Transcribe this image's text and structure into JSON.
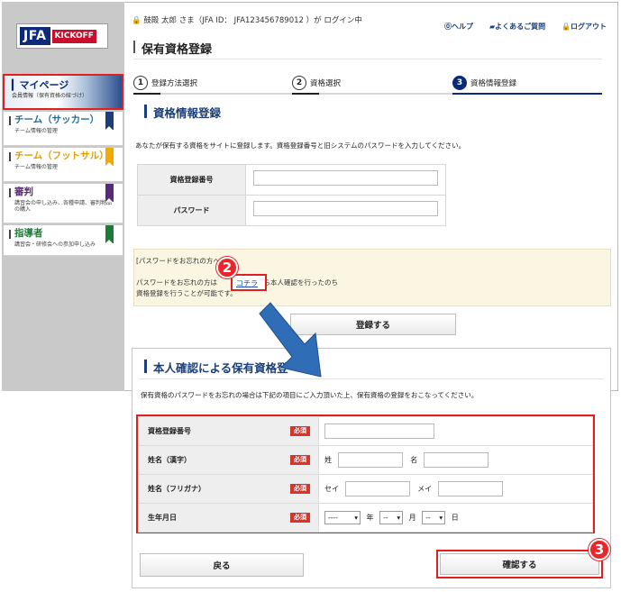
{
  "logo": {
    "jfa": "JFA",
    "kickoff": "KICKOFF"
  },
  "sidebar": {
    "items": [
      {
        "label": "マイページ",
        "sub": "会員情報（保有資格の紐づけ）"
      },
      {
        "label": "チーム（サッカー）",
        "sub": "チーム情報の管理",
        "color": "#1a3f7a"
      },
      {
        "label": "チーム（フットサル）",
        "sub": "チーム情報の管理",
        "color": "#f2a900"
      },
      {
        "label": "審判",
        "sub": "講習会の申し込み、各種申請、審判物品の購入",
        "color": "#5a2a7a"
      },
      {
        "label": "指導者",
        "sub": "講習会・研修会への参加申し込み",
        "color": "#1f7a3a"
      }
    ]
  },
  "header": {
    "user_line": "鼓殿 太郎 さま（JFA ID： JFA123456789012 ）が ログイン中",
    "help": "ヘルプ",
    "faq": "よくあるご質問",
    "logout": "ログアウト",
    "page_title": "保有資格登録"
  },
  "steps": [
    {
      "num": "1",
      "label": "登録方法選択"
    },
    {
      "num": "2",
      "label": "資格選択"
    },
    {
      "num": "3",
      "label": "資格情報登録"
    }
  ],
  "section": {
    "title": "資格情報登録",
    "intro": "あなたが保有する資格をサイトに登録します。資格登録番号と旧システムのパスワードを入力してください。"
  },
  "form1": {
    "fields": [
      {
        "label": "資格登録番号",
        "value": ""
      },
      {
        "label": "パスワード",
        "value": ""
      }
    ]
  },
  "forgot": {
    "heading": "[パスワードをお忘れの方へ]",
    "line_before": "パスワードをお忘れの方は",
    "link": "コチラ",
    "line_after": "から本人確認を行ったのち",
    "line2": "資格登録を行うことが可能です。"
  },
  "register_button": "登録する",
  "overlay": {
    "title": "本人確認による保有資格登",
    "intro": "保有資格のパスワードをお忘れの場合は下記の項目にご入力頂いた上、保有資格の登録をおこなってください。",
    "required": "必須",
    "fields": {
      "reg_number": "資格登録番号",
      "kanji_name": "姓名（漢字）",
      "kana_name": "姓名（フリガナ）",
      "birthdate": "生年月日"
    },
    "prefixes": {
      "sei": "姓",
      "mei": "名",
      "sei_kana": "セイ",
      "mei_kana": "メイ"
    },
    "date": {
      "year_value": "----",
      "month_value": "--",
      "day_value": "--",
      "year_label": "年",
      "month_label": "月",
      "day_label": "日"
    },
    "back_button": "戻る",
    "confirm_button": "確認する"
  },
  "badges": {
    "two": "2",
    "three": "3"
  },
  "colors": {
    "navy": "#0b2a78",
    "accent_red": "#e02020",
    "link_blue": "#1a4fa0",
    "arrow_blue": "#2f6eb7"
  }
}
